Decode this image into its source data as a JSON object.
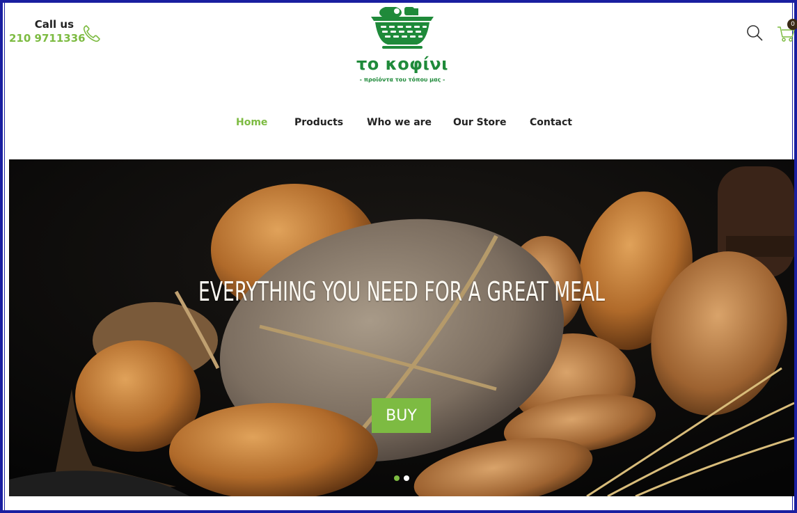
{
  "header": {
    "call_label": "Call us",
    "phone": "210 9711336",
    "logo_name": "το κοφίνι",
    "logo_tagline": "- προϊόντα του τόπου μας -",
    "cart_count": "0"
  },
  "nav": {
    "items": [
      {
        "label": "Home",
        "active": true
      },
      {
        "label": "Products",
        "active": false
      },
      {
        "label": "Who we are",
        "active": false
      },
      {
        "label": "Our Store",
        "active": false
      },
      {
        "label": "Contact",
        "active": false
      }
    ]
  },
  "hero": {
    "headline": "EVERYTHING YOU NEED FOR A GREAT MEAL",
    "button_label": "BUY",
    "slides": 2,
    "active_slide": 1
  },
  "colors": {
    "accent": "#7dbb42",
    "logo_green": "#1f8a3a",
    "frame": "#1a1fa0"
  },
  "icons": [
    "phone-icon",
    "search-icon",
    "cart-icon"
  ]
}
